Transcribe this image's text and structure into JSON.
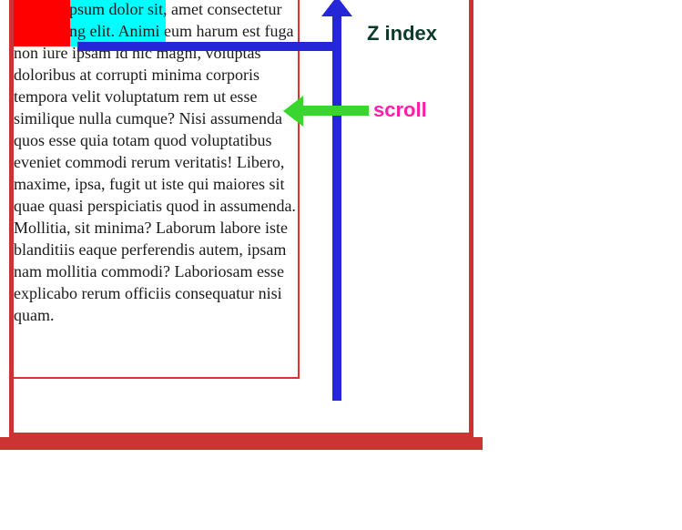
{
  "labels": {
    "zindex": "Z index",
    "scroll": "scroll"
  },
  "text": {
    "lorem": "ipsum dolor sit, amet consectetur adipisicing elit. Animi eum harum est fuga non iure ipsam id hic magni, voluptas doloribus at corrupti minima corporis tempora velit voluptatum rem ut esse similique nulla cumque? Nisi assumenda quos esse quia totam quod voluptatibus eveniet commodi rerum veritatis! Libero, maxime, ipsa, fugit ut iste qui maiores sit quae quasi perspiciatis quod in assumenda. Mollitia, sit minima? Laborum labore iste blanditiis eaque perferendis autem, ipsam nam mollitia commodi? Laboriosam esse explicabo rerum officiis consequatur nisi quam."
  },
  "colors": {
    "frame": "#cc3333",
    "cyan": "#00ffff",
    "red": "#ff0000",
    "blue": "#2626d9",
    "green": "#39d630",
    "pink": "#ff1fa6",
    "darkgreen": "#0a3a2a"
  }
}
